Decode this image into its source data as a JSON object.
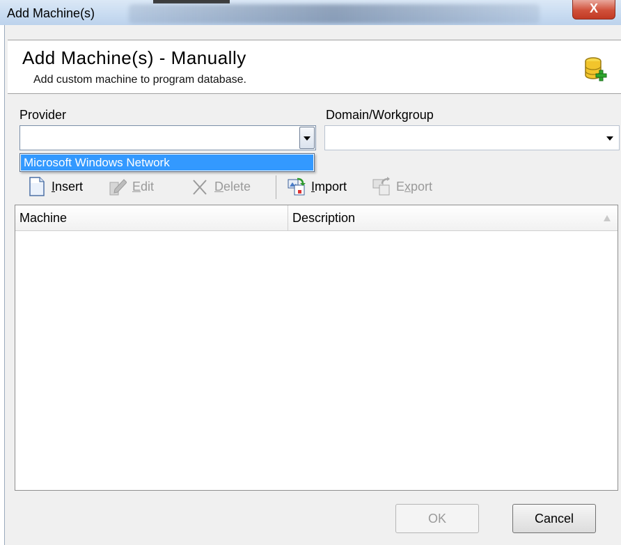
{
  "window": {
    "title": "Add Machine(s)",
    "close_glyph": "X"
  },
  "header": {
    "title": "Add Machine(s) - Manually",
    "subtitle": "Add custom machine to program database.",
    "icon": "database-add-icon"
  },
  "provider": {
    "label": "Provider",
    "value": "",
    "dropdown_open": true,
    "options": [
      "Microsoft Windows Network"
    ],
    "highlighted_option": "Microsoft Windows Network"
  },
  "domain": {
    "label": "Domain/Workgroup",
    "value": ""
  },
  "toolbar": {
    "insert": {
      "label": "Insert",
      "enabled": true,
      "icon": "document-icon"
    },
    "edit": {
      "label": "Edit",
      "enabled": false,
      "icon": "edit-icon"
    },
    "delete": {
      "label": "Delete",
      "enabled": false,
      "icon": "delete-x-icon"
    },
    "import": {
      "label": "Import",
      "enabled": true,
      "icon": "import-icon"
    },
    "export": {
      "label": "Export",
      "enabled": false,
      "icon": "export-icon"
    }
  },
  "table": {
    "columns": [
      "Machine",
      "Description"
    ],
    "rows": []
  },
  "buttons": {
    "ok": "OK",
    "cancel": "Cancel",
    "ok_enabled": false
  },
  "colors": {
    "selection": "#3399ff",
    "close_button": "#c9442c",
    "disabled_text": "#9a9a9a"
  }
}
